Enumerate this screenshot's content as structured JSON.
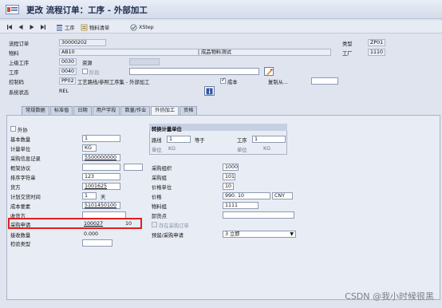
{
  "title": "更改 流程订单：工序 - 外部加工",
  "toolbar": {
    "work_label": "工序",
    "material_list_label": "物料清单",
    "xstep_label": "XStep"
  },
  "header": {
    "order_label": "流程订单",
    "order_value": "30000202",
    "type_label": "类型",
    "type_value": "ZP01",
    "material_label": "物料",
    "material_value": "AB10",
    "material_desc": "成品物料测试",
    "plant_label": "工厂",
    "plant_value": "1110",
    "upper_op_label": "上级工序",
    "upper_op_value": "0030",
    "resource_label": "资源",
    "op_label": "工序",
    "op_value": "0040",
    "phase_label": "阶段",
    "control_key_label": "控制码",
    "control_key_value": "PP02",
    "control_key_desc": "工艺路线/参照工序集 - 外部加工",
    "cost_label": "成本",
    "copy_from_label": "复制从...",
    "sys_status_label": "系统状态",
    "sys_status_value": "REL"
  },
  "tabs": [
    "常规数据",
    "标准值",
    "日期",
    "用户字段",
    "数量/作业",
    "外协加工",
    "资格"
  ],
  "detail": {
    "outsourcing_label": "外协",
    "base_qty_label": "基本数量",
    "base_qty_value": "1",
    "unit_label": "计量单位",
    "unit_value": "KG",
    "info_record_label": "采购信息记录",
    "info_record_value": "5500000000",
    "framework_label": "框架协议",
    "sort_label": "排序字符串",
    "sort_value": "123",
    "vendor_label": "货方",
    "vendor_value": "1001625",
    "planned_time_label": "计划交货时间",
    "planned_time_value": "1",
    "planned_time_unit": "天",
    "cost_element_label": "成本要素",
    "cost_element_value": "5101450100",
    "receiver_label": "收货方",
    "pr_label": "采购申请",
    "pr_value": "100027",
    "pr_item": "10",
    "receipt_qty_label": "接收数量",
    "receipt_qty_value": "0.000",
    "inspection_label": "检验类型",
    "conv_title": "转换计量单位",
    "route_label": "路线",
    "route_value": "1",
    "equal_label": "等于",
    "conv_op_label": "工序",
    "conv_op_value": "1",
    "unit_a_label": "单位",
    "unit_a_value": "KG",
    "unit_b_label": "单位",
    "unit_b_value": "KG",
    "purch_org_label": "采购组织",
    "purch_org_value": "1000",
    "purch_group_label": "采购组",
    "purch_group_value": "101",
    "price_unit_label": "价格单位",
    "price_unit_value": "10",
    "price_label": "价格",
    "price_value": "990. 10",
    "currency_value": "CNY",
    "mat_group_label": "物料组",
    "mat_group_value": "1111",
    "unloading_label": "卸货点",
    "existing_po_label": "存在采购订单",
    "reservation_label": "预留/采购申请",
    "reservation_value": "3 立即"
  },
  "watermark": "CSDN @我小时候很黑",
  "colors": {
    "highlight": "#e02020",
    "background": "#dfe4ef"
  }
}
